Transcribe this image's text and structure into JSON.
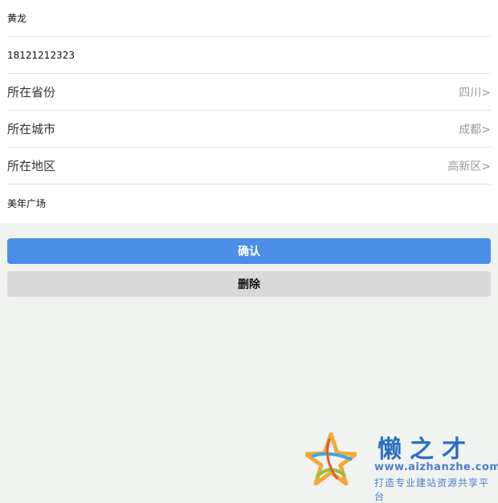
{
  "form": {
    "name_value": "黄龙",
    "phone_value": "18121212323",
    "province": {
      "label": "所在省份",
      "value": "四川>"
    },
    "city": {
      "label": "所在城市",
      "value": "成都>"
    },
    "district": {
      "label": "所在地区",
      "value": "高新区>"
    },
    "address_value": "美年广场"
  },
  "buttons": {
    "confirm_label": "确认",
    "delete_label": "删除"
  },
  "watermark": {
    "title": "懒之才",
    "url": "www.aizhanzhe.com",
    "slogan": "打造专业建站资源共享平台"
  },
  "colors": {
    "confirm_bg": "#4a8ee8",
    "delete_bg": "#d9d9d9",
    "page_bg": "#f1f3f1"
  }
}
